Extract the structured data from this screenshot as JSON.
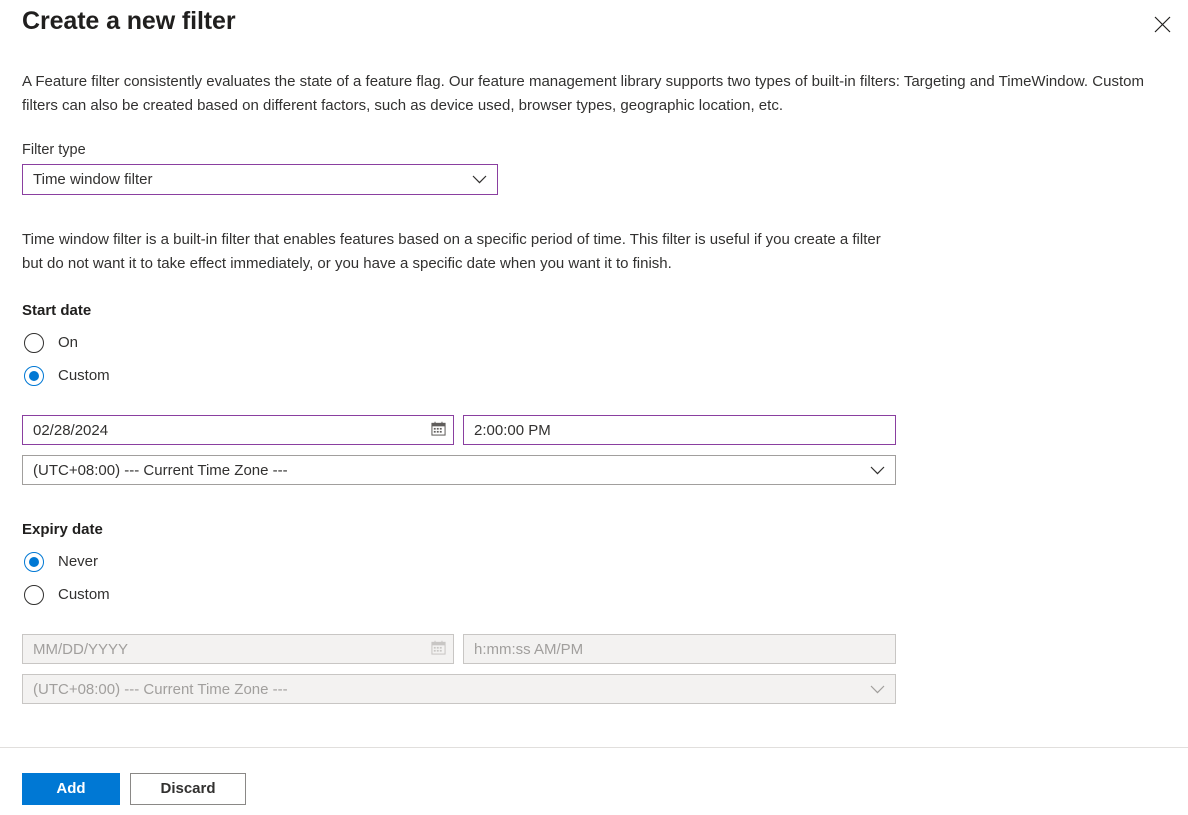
{
  "header": {
    "title": "Create a new filter",
    "close_icon": "close-icon"
  },
  "description": "A Feature filter consistently evaluates the state of a feature flag. Our feature management library supports two types of built-in filters: Targeting and TimeWindow. Custom filters can also be created based on different factors, such as device used, browser types, geographic location, etc.",
  "filter_type": {
    "label": "Filter type",
    "value": "Time window filter",
    "chevron_icon": "chevron-down-icon",
    "border_color": "#8a3fa0"
  },
  "filter_description": "Time window filter is a built-in filter that enables features based on a specific period of time. This filter is useful if you create a filter but do not want it to take effect immediately, or you have a specific date when you want it to finish.",
  "start_date": {
    "label": "Start date",
    "options": [
      {
        "label": "On",
        "checked": false
      },
      {
        "label": "Custom",
        "checked": true
      }
    ],
    "date": {
      "value": "02/28/2024",
      "placeholder": "MM/DD/YYYY",
      "calendar_icon": "calendar-icon",
      "disabled": false
    },
    "time": {
      "value": "2:00:00 PM",
      "placeholder": "h:mm:ss AM/PM",
      "disabled": false
    },
    "timezone": {
      "value": "(UTC+08:00) --- Current Time Zone ---",
      "chevron_icon": "chevron-down-icon",
      "disabled": false
    }
  },
  "expiry_date": {
    "label": "Expiry date",
    "options": [
      {
        "label": "Never",
        "checked": true
      },
      {
        "label": "Custom",
        "checked": false
      }
    ],
    "date": {
      "value": "",
      "placeholder": "MM/DD/YYYY",
      "calendar_icon": "calendar-icon",
      "disabled": true
    },
    "time": {
      "value": "",
      "placeholder": "h:mm:ss AM/PM",
      "disabled": true
    },
    "timezone": {
      "value": "(UTC+08:00) --- Current Time Zone ---",
      "chevron_icon": "chevron-down-icon",
      "disabled": true
    }
  },
  "footer": {
    "add_label": "Add",
    "discard_label": "Discard",
    "primary_color": "#0078d4"
  }
}
